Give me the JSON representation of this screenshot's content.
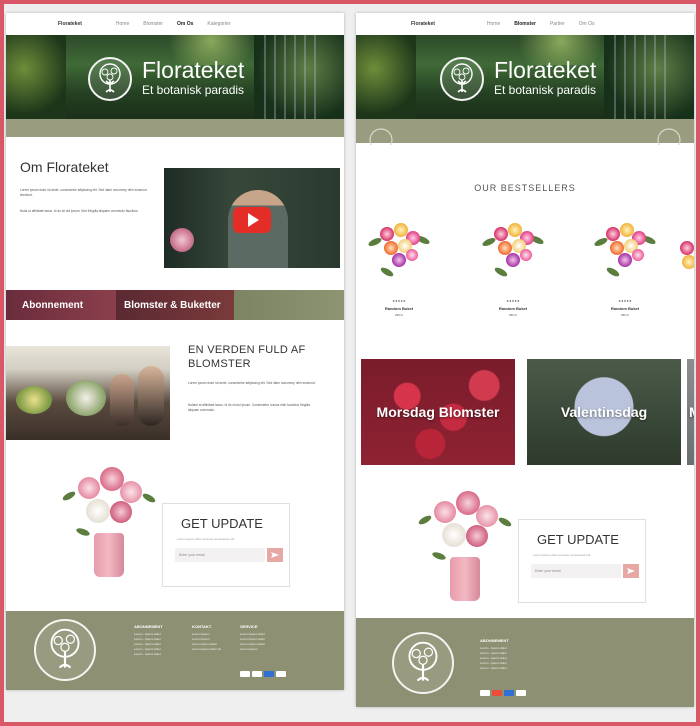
{
  "colors": {
    "frame": "#d95868",
    "olive": "#9a9c7f",
    "footer": "#8d9072",
    "accent_send": "#e7a7a4",
    "youtube_red": "#e52d27"
  },
  "left": {
    "nav": {
      "brand": "Florateket",
      "links": [
        "Home",
        "Blomster",
        "Om Os",
        "Kategorier"
      ],
      "active_index": 2
    },
    "hero": {
      "title": "Florateket",
      "subtitle": "Et botanisk paradis",
      "logo_icon": "tree-icon"
    },
    "about": {
      "title": "Om Florateket",
      "para1": "Lorem ipsum dolor sit amet, consectetur adipiscing elit. Sed diam nonummy nibh euismod tincidunt.",
      "para2": "Nulla ut affinitate lacus. Id do sit dui ipsum. Sed fringilla aliquam commodo faucibus."
    },
    "video": {
      "play_icon": "play-icon"
    },
    "categories": [
      "Abonnement",
      "Blomster & Buketter",
      ""
    ],
    "world": {
      "title_line1": "EN VERDEN FULD AF",
      "title_line2": "BLOMSTER",
      "para1": "Lorem ipsum dolor sit amet, consectetur adipiscing elit. Sed diam nonummy nibh euismod.",
      "para2": "Nullam at affinitate lacus. Id do sit dui ipsum. Consectetur cursus nibh faucibus fringilla aliquam commodo."
    },
    "update": {
      "title": "GET UPDATE",
      "small": "Lorem ipsum dolor sit amet consectetur elit",
      "placeholder": "Enter your email",
      "send_icon": "send-icon"
    },
    "footer": {
      "cols": [
        {
          "heading": "ABONNEMENT",
          "links": [
            "Lorem - Ipsum dolor",
            "Lorem - Ipsum dolor",
            "Lorem - Ipsum dolor",
            "Lorem - Ipsum dolor",
            "Lorem - Ipsum dolor"
          ]
        },
        {
          "heading": "KONTAKT",
          "links": [
            "Lorem Ipsum",
            "Lorem Ipsum",
            "Lorem Ipsum dolor",
            "Lorem Ipsum dolor sit"
          ]
        },
        {
          "heading": "SERVICE",
          "links": [
            "Lorem Ipsum dolor",
            "Lorem Ipsum dolor",
            "Lorem Ipsum dolor",
            "Lorem Ipsum"
          ]
        }
      ]
    }
  },
  "right": {
    "nav": {
      "brand": "Florateket",
      "links": [
        "Home",
        "Blomster",
        "Partier",
        "Om Os"
      ],
      "active_index": 1
    },
    "hero": {
      "title": "Florateket",
      "subtitle": "Et botanisk paradis"
    },
    "bestsellers": {
      "title": "OUR BESTSELLERS",
      "products": [
        {
          "stars": "★★★★★",
          "name": "Random Buket",
          "price": "299 kr"
        },
        {
          "stars": "★★★★★",
          "name": "Random Buket",
          "price": "299 kr"
        },
        {
          "stars": "★★★★★",
          "name": "Random Buket",
          "price": "299 kr"
        }
      ]
    },
    "tiles": [
      "Morsdag Blomster",
      "Valentinsdag",
      "M"
    ],
    "update": {
      "title": "GET UPDATE",
      "small": "Lorem ipsum dolor sit amet consectetur elit",
      "placeholder": "Enter your email"
    },
    "footer": {
      "heading": "ABONNEMENT",
      "links": [
        "Lorem - Ipsum dolor",
        "Lorem - Ipsum dolor",
        "Lorem - Ipsum dolor",
        "Lorem - Ipsum dolor",
        "Lorem - Ipsum dolor"
      ]
    }
  }
}
